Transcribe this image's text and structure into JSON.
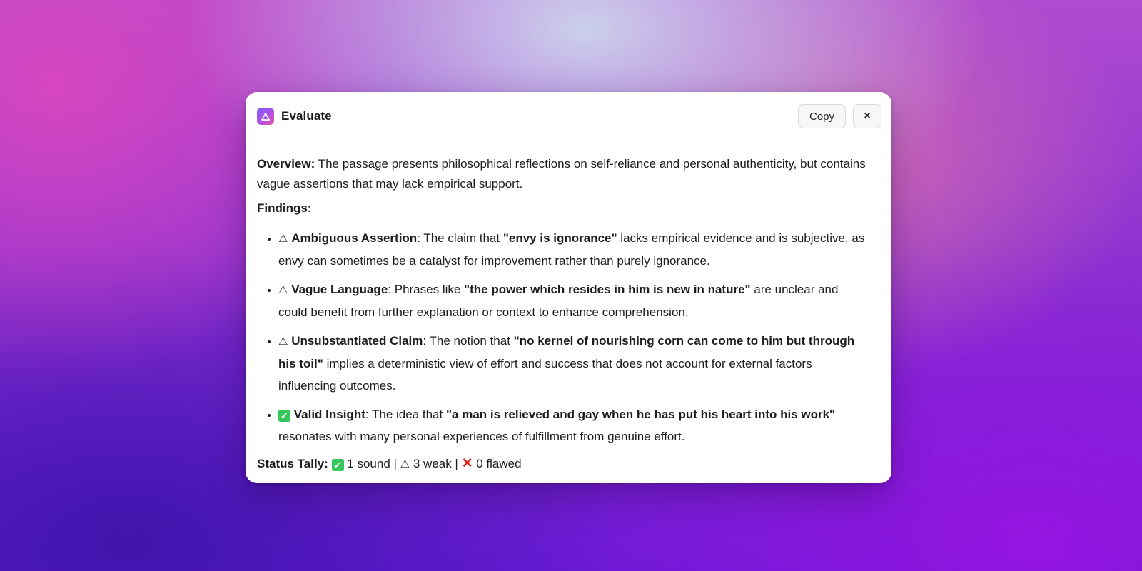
{
  "dialog": {
    "title": "Evaluate",
    "copy_label": "Copy",
    "close_label": "×"
  },
  "overview": {
    "label": "Overview:",
    "text": " The passage presents philosophical reflections on self-reliance and personal authenticity, but contains vague assertions that may lack empirical support."
  },
  "findings_label": "Findings:",
  "findings": [
    {
      "icon": "warning-icon",
      "icon_char": "⚠",
      "title": "Ambiguous Assertion",
      "intro": ": The claim that ",
      "quote": "\"envy is ignorance\"",
      "rest": " lacks empirical evidence and is subjective, as envy can sometimes be a catalyst for improvement rather than purely ignorance."
    },
    {
      "icon": "warning-icon",
      "icon_char": "⚠",
      "title": "Vague Language",
      "intro": ": Phrases like ",
      "quote": "\"the power which resides in him is new in nature\"",
      "rest": " are unclear and could benefit from further explanation or context to enhance comprehension."
    },
    {
      "icon": "warning-icon",
      "icon_char": "⚠",
      "title": "Unsubstantiated Claim",
      "intro": ": The notion that ",
      "quote": "\"no kernel of nourishing corn can come to him but through his toil\"",
      "rest": " implies a deterministic view of effort and success that does not account for external factors influencing outcomes."
    },
    {
      "icon": "check-icon",
      "icon_char": "✓",
      "title": "Valid Insight",
      "intro": ": The idea that ",
      "quote": "\"a man is relieved and gay when he has put his heart into his work\"",
      "rest": " resonates with many personal experiences of fulfillment from genuine effort."
    }
  ],
  "tally": {
    "label": "Status Tally:",
    "sound": " 1 sound | ",
    "weak": " 3 weak | ",
    "flawed": " 0 flawed",
    "check_char": "✓",
    "warn_char": "⚠",
    "cross_char": "✕"
  },
  "colors": {
    "accent_gradient_start": "#7b5cf5",
    "accent_gradient_end": "#e8559a",
    "check_green": "#34c759",
    "cross_red": "#e0241b"
  }
}
